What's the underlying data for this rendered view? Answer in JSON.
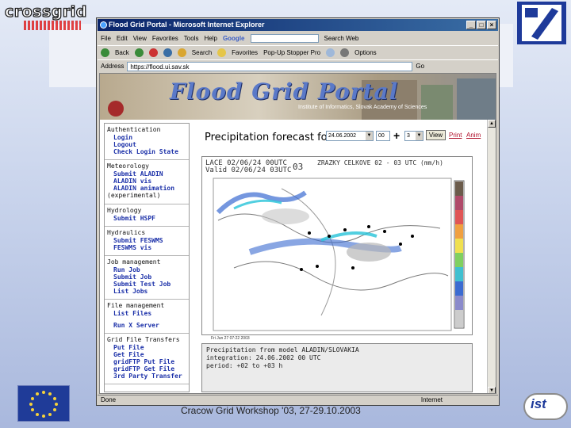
{
  "slide": {
    "logo_text": "crossgrid",
    "footer": "Cracow Grid Workshop '03, 27-29.10.2003",
    "ist_logo": "ist"
  },
  "browser": {
    "title": "Flood Grid Portal - Microsoft Internet Explorer",
    "menu": [
      "File",
      "Edit",
      "View",
      "Favorites",
      "Tools",
      "Help"
    ],
    "google_label": "Google",
    "search_web_label": "Search Web",
    "toolbar": {
      "back": "Back",
      "search": "Search",
      "favorites": "Favorites",
      "popup": "Pop-Up Stopper Pro",
      "options": "Options"
    },
    "address_label": "Address",
    "address_value": "https://flood.ui.sav.sk",
    "go_label": "Go",
    "status_left": "Done",
    "status_zone": "Internet"
  },
  "portal": {
    "banner_title": "Flood Grid Portal",
    "banner_sub": "Institute of Informatics, Slovak Academy of Sciences",
    "sidebar": [
      {
        "head": "Authentication",
        "items": [
          "Login",
          "Logout",
          "Check Login State"
        ]
      },
      {
        "head": "Meteorology",
        "items": [
          "Submit ALADIN",
          "ALADIN vis",
          "ALADIN animation"
        ],
        "tail": "(experimental)"
      },
      {
        "head": "Hydrology",
        "items": [
          "Submit HSPF"
        ]
      },
      {
        "head": "Hydraulics",
        "items": [
          "Submit FESWMS",
          "FESWMS vis"
        ]
      },
      {
        "head": "Job management",
        "items": [
          "Run Job",
          "Submit Job",
          "Submit Test Job",
          "List Jobs"
        ]
      },
      {
        "head": "File management",
        "items": [
          "List Files",
          "",
          "Run X Server"
        ]
      },
      {
        "head": "Grid File Transfers",
        "items": [
          "Put File",
          "Get File",
          "gridFTP Put File",
          "gridFTP Get File",
          "3rd Party Transfer"
        ]
      }
    ],
    "forecast_title": "Precipitation forecast for",
    "date_value": "24.06.2002",
    "run_value": "00",
    "plus": "+",
    "offset_value": "3",
    "view_button": "View",
    "link_print": "Print",
    "link_anim": "Anim",
    "map_label_1": "LACE 02/06/24 00UTC",
    "map_label_2": "Valid 02/06/24 03UTC",
    "map_step": "03",
    "map_right_label": "ZRAZKY CELKOVE 02 - 03 UTC (mm/h)",
    "map_caption": "Fri Jun 27 07:22 2003",
    "info_lines": [
      "Precipitation from model ALADIN/SLOVAKIA",
      "integration: 24.06.2002 00 UTC",
      "period:      +02 to +03 h"
    ]
  },
  "colors": {
    "title_gradient_start": "#0a246a",
    "title_gradient_end": "#3a6ea5",
    "link": "#1a2fa8",
    "portal_banner_text": "#5a79c8"
  }
}
